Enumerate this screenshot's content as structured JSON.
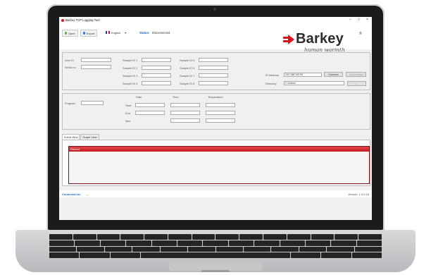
{
  "window": {
    "title": "Barkey TCP Logging Tool",
    "minimize": "–",
    "maximize": "□",
    "close": "×"
  },
  "toolbar": {
    "open_label": "Open",
    "export_label": "Export",
    "language": "English",
    "language_caret": "▾",
    "status_label": "Status:",
    "status_value": "Disconnected"
  },
  "logo": {
    "brand": "Barkey",
    "registered": "®",
    "tagline": "human warmth",
    "color": "#d9161c"
  },
  "identity_panel": {
    "user_id_label": "User ID",
    "user_id_value": "",
    "serial_label": "Serial no.",
    "serial_value": "",
    "sample_labels": [
      "Sample ID 1",
      "Sample ID 2",
      "Sample ID 3",
      "Sample ID 4",
      "Sample ID 5",
      "Sample ID 6",
      "Sample ID 7",
      "Sample ID 8"
    ],
    "ip_label": "IP Address",
    "ip_value": "192.168.100.99",
    "connect_label": "Connect",
    "disconnect_label": "Disconnect",
    "directory_label": "Directory",
    "directory_value": "C:\\Users\\",
    "browse_label": "..."
  },
  "program_panel": {
    "program_label": "Program",
    "program_value": "",
    "col_date": "Date",
    "col_time": "Time",
    "col_temperature": "Temperature",
    "row_start": "Start",
    "row_end": "End",
    "row_max": "Max"
  },
  "tabs": [
    {
      "label": "Event View",
      "active": true
    },
    {
      "label": "Graph View",
      "active": false
    }
  ],
  "event_view": {
    "header": "Record"
  },
  "statusbar": {
    "connected_label": "Connected to:",
    "connected_value": "---",
    "version": "Version: 1.0.0.18"
  }
}
